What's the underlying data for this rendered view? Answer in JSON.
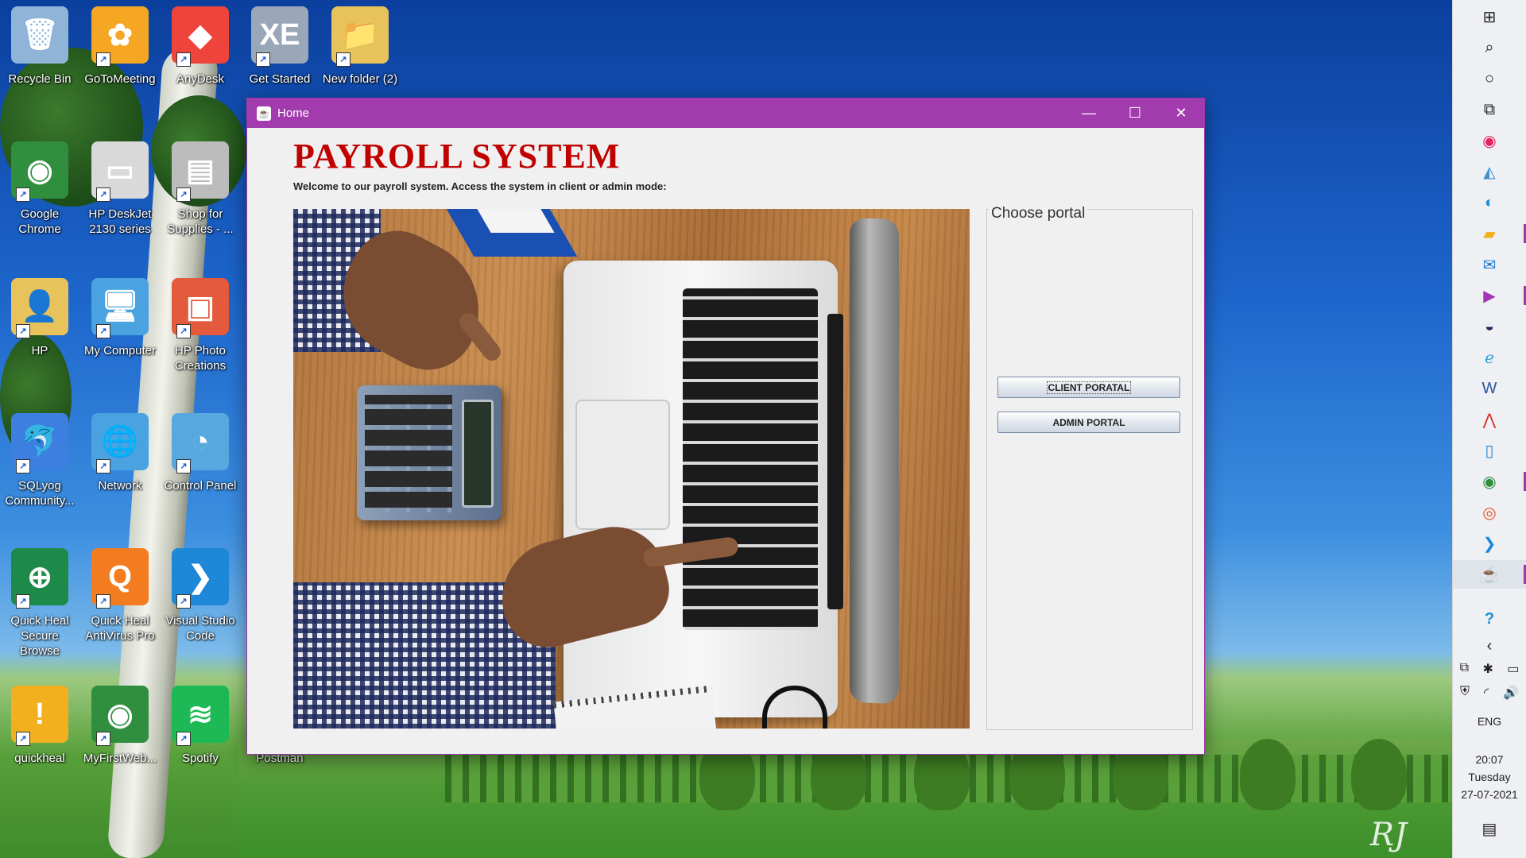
{
  "desktop": {
    "icons": [
      {
        "label": "Recycle Bin",
        "glyph": "🗑",
        "color": "#8fb4d8"
      },
      {
        "label": "GoToMeeting",
        "glyph": "✿",
        "color": "#f5a623"
      },
      {
        "label": "AnyDesk",
        "glyph": "◆",
        "color": "#ef443b"
      },
      {
        "label": "Get Started",
        "glyph": "XE",
        "color": "#9aa7b8"
      },
      {
        "label": "New folder (2)",
        "glyph": "📁",
        "color": "#e8c35c"
      },
      {
        "label": "Google Chrome",
        "glyph": "◉",
        "color": "#2f8f3f"
      },
      {
        "label": "HP DeskJet 2130 series",
        "glyph": "▭",
        "color": "#d9d9d9"
      },
      {
        "label": "Shop for Supplies - ...",
        "glyph": "▤",
        "color": "#bcbcbc"
      },
      {
        "label": "HP",
        "glyph": "👤",
        "color": "#e8c35c"
      },
      {
        "label": "My Computer",
        "glyph": "🖥",
        "color": "#4aa3e0"
      },
      {
        "label": "HP Photo Creations",
        "glyph": "▣",
        "color": "#e45a3c"
      },
      {
        "label": "SQLyog Community...",
        "glyph": "🐬",
        "color": "#3d7fe0"
      },
      {
        "label": "Network",
        "glyph": "🌐",
        "color": "#4aa3e0"
      },
      {
        "label": "Control Panel",
        "glyph": "◔",
        "color": "#58a8e0"
      },
      {
        "label": "Quick Heal Secure Browse",
        "glyph": "⊕",
        "color": "#1d8a4a"
      },
      {
        "label": "Quick Heal AntiVirus Pro",
        "glyph": "Q",
        "color": "#f47c20"
      },
      {
        "label": "Visual Studio Code",
        "glyph": "❯",
        "color": "#1e88d8"
      },
      {
        "label": "quickheal",
        "glyph": "!",
        "color": "#f2b01e"
      },
      {
        "label": "MyFirstWeb...",
        "glyph": "◉",
        "color": "#2f8f3f"
      },
      {
        "label": "Spotify",
        "glyph": "≋",
        "color": "#1db954"
      },
      {
        "label": "Postman",
        "glyph": "●",
        "color": "#ef6c36"
      }
    ],
    "signature": "RJ"
  },
  "window": {
    "title": "Home",
    "minimize_glyph": "—",
    "maximize_glyph": "☐",
    "close_glyph": "✕",
    "heading": "PAYROLL SYSTEM",
    "welcome_text": "Welcome to our payroll system. Access the system in client or admin mode:",
    "portal_group_label": "Choose portal",
    "client_button": "CLIENT PORATAL",
    "admin_button": "ADMIN PORTAL"
  },
  "taskbar": {
    "items": [
      {
        "name": "start",
        "glyph": "⊞",
        "color": "#222222"
      },
      {
        "name": "search",
        "glyph": "⌕",
        "color": "#222222"
      },
      {
        "name": "cortana",
        "glyph": "○",
        "color": "#222222"
      },
      {
        "name": "task-view",
        "glyph": "⧉",
        "color": "#222222"
      },
      {
        "name": "recorder",
        "glyph": "◉",
        "color": "#e0245e"
      },
      {
        "name": "app-generic",
        "glyph": "◭",
        "color": "#3f8fcf"
      },
      {
        "name": "edge",
        "glyph": "◐",
        "color": "#1b8fd6"
      },
      {
        "name": "file-explorer",
        "glyph": "▰",
        "color": "#f2b01e"
      },
      {
        "name": "mail",
        "glyph": "✉",
        "color": "#1976d2"
      },
      {
        "name": "visual-studio",
        "glyph": "▶",
        "color": "#a234b5"
      },
      {
        "name": "eclipse",
        "glyph": "◒",
        "color": "#2c2255"
      },
      {
        "name": "internet-explorer",
        "glyph": "ℯ",
        "color": "#2d9fe0"
      },
      {
        "name": "word",
        "glyph": "W",
        "color": "#2b579a"
      },
      {
        "name": "acrobat",
        "glyph": "⋀",
        "color": "#d62b1f"
      },
      {
        "name": "phone",
        "glyph": "▯",
        "color": "#1e88d8"
      },
      {
        "name": "chrome",
        "glyph": "◉",
        "color": "#2f8f3f"
      },
      {
        "name": "ubuntu",
        "glyph": "◎",
        "color": "#e95420"
      },
      {
        "name": "vscode",
        "glyph": "❯",
        "color": "#1e88d8"
      },
      {
        "name": "java-app",
        "glyph": "☕",
        "color": "#c04a1b"
      }
    ],
    "help_glyph": "?",
    "chevron_glyph": "‹",
    "tray": [
      "⧉",
      "✱",
      "▭",
      "⛨",
      "◜",
      "🔊"
    ],
    "language": "ENG",
    "time": "20:07",
    "day": "Tuesday",
    "date": "27-07-2021",
    "notification_glyph": "▤"
  },
  "colors": {
    "titlebar": "#a23bad",
    "heading": "#c10000",
    "taskbar_bg": "#eef0f3"
  }
}
